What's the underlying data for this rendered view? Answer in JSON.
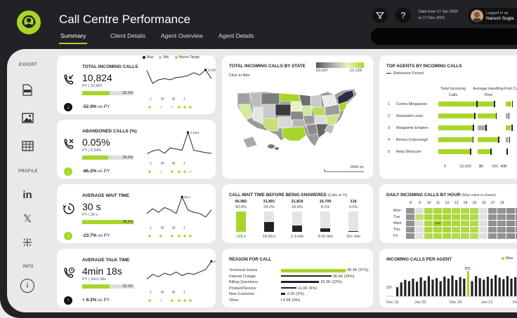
{
  "header": {
    "title": "Call Centre Performance",
    "tabs": [
      {
        "label": "Summary",
        "active": true
      },
      {
        "label": "Client Details",
        "active": false
      },
      {
        "label": "Agent Overview",
        "active": false
      },
      {
        "label": "Agent Details",
        "active": false
      }
    ],
    "date_from": "Data from 17 Jan 2020",
    "date_to": "to 17 Dec 2021",
    "logged_in_label": "Logged in as",
    "user_name": "Naresh Sugla",
    "help_symbol": "?"
  },
  "sidebar": {
    "export_label": "EXPORT",
    "profile_label": "PROFILE",
    "info_label": "INFO",
    "export_items": [
      "pdf-icon",
      "image-icon",
      "table-icon"
    ],
    "profile_items": [
      "linkedin-icon",
      "x-icon",
      "tableau-icon"
    ],
    "linkedin_text": "in",
    "x_text": "𝕏",
    "info_text": "i",
    "pdf_text": "PDF"
  },
  "legend": {
    "max": "Max",
    "min": "Min",
    "above": "Above Target"
  },
  "months": [
    "J",
    "M",
    "M",
    "J"
  ],
  "kpis": [
    {
      "title": "TOTAL INCOMING CALLS",
      "value": "10,824",
      "py": "PY | 22,982",
      "bar_pct": 0.521,
      "bar_label": "52.1%",
      "delta": "-52.9%",
      "delta_suffix": "vs PY",
      "delta_dir": "down",
      "peak_label": "22,982",
      "spark": [
        0.9,
        0.35,
        0.5,
        0.55,
        0.5,
        0.6,
        0.62,
        0.68,
        0.8,
        0.7,
        0.92,
        0.55
      ],
      "dots": [
        1,
        0,
        0,
        1,
        1,
        1
      ]
    },
    {
      "title": "ABANDONED CALLS (%)",
      "value": "0.05%",
      "py": "PY | 0.34%",
      "bar_pct": 0.502,
      "bar_label": "50.2%",
      "delta": "-86.2%",
      "delta_suffix": "vs PY",
      "delta_dir": "up",
      "peak_label": "2.14%",
      "spark": [
        0.1,
        0.22,
        0.28,
        0.12,
        0.35,
        0.3,
        0.25,
        1.0,
        0.25,
        0.2,
        0.15,
        0.12
      ],
      "dots": [
        1,
        0,
        1,
        1,
        1,
        0
      ]
    },
    {
      "title": "AVERAGE WAIT TIME",
      "value": "30 s",
      "py": "PY | 39 s",
      "bar_pct": 0.983,
      "bar_label": "98.3%",
      "delta": "-23.7%",
      "delta_suffix": "vs PY",
      "delta_dir": "down",
      "peak_label": "94 s",
      "spark": [
        0.3,
        0.5,
        0.35,
        0.55,
        0.45,
        0.3,
        1.0,
        0.45,
        0.35,
        0.3,
        0.15,
        0.45
      ],
      "dots": [
        1,
        1,
        1,
        1,
        1,
        1
      ]
    },
    {
      "title": "AVERAGE TALK TIME",
      "value": "4min 18s",
      "py": "PY | 3min 58s",
      "bar_pct": 0.521,
      "bar_label": "52.1%",
      "delta": "+ 8.3%",
      "delta_suffix": "vs PY",
      "delta_dir": "up-dark",
      "peak_label": "258",
      "spark": [
        0.25,
        0.45,
        0.35,
        0.5,
        0.42,
        0.55,
        0.4,
        0.5,
        0.45,
        0.55,
        0.65,
        1.0
      ],
      "dots": [
        1,
        0,
        1,
        1,
        1,
        1
      ]
    }
  ],
  "map_card": {
    "title": "TOTAL INCOMING CALLS BY STATE",
    "subtitle": "Click to filter",
    "legend_min": "10,697",
    "legend_max": "12,129",
    "scale_label": "1500 mi"
  },
  "agents_card": {
    "title": "TOP AGENTS BY INCOMING CALLS",
    "legend": "Reference Period",
    "columns": [
      "Total Incoming Calls",
      "Average Handling Time",
      "First Call Resolution"
    ],
    "agents": [
      {
        "rank": "1",
        "name": "Corine Mingasson",
        "calls": 0.95,
        "aht": 0.78,
        "fcr": 0.3
      },
      {
        "rank": "2",
        "name": "Reinwald Lowis",
        "calls": 0.9,
        "aht": 0.85,
        "fcr": 0.1
      },
      {
        "rank": "3",
        "name": "Margarete Empten",
        "calls": 0.87,
        "aht": 0.38,
        "fcr": 0.28
      },
      {
        "rank": "4",
        "name": "Brinna Colecrough",
        "calls": 0.86,
        "aht": 0.98,
        "fcr": 0.15
      },
      {
        "rank": "5",
        "name": "Reta Winscum",
        "calls": 0.8,
        "aht": 0.6,
        "fcr": 0.0
      }
    ],
    "axis1": [
      "0",
      "10,000",
      "20"
    ],
    "axis2": [
      "0",
      "200",
      "400",
      "0"
    ],
    "axis3": [
      "1"
    ]
  },
  "wait_card": {
    "title": "CALL WAIT TIME BEFORE BEING ANSWERED",
    "subtitle": "(Calls vs %)",
    "buckets": [
      {
        "count": "66,982",
        "pct": "50.8%",
        "frac": 0.51,
        "label": "<15 s",
        "color": "#a8d52a"
      },
      {
        "count": "31,891",
        "pct": "24.2%",
        "frac": 0.24,
        "label": "15-60 s",
        "color": "#222226"
      },
      {
        "count": "21,818",
        "pct": "16.6%",
        "frac": 0.166,
        "label": "1-3 min",
        "color": "#222226"
      },
      {
        "count": "10,709",
        "pct": "8.1%",
        "frac": 0.081,
        "label": "3-10 min",
        "color": "#222226"
      },
      {
        "count": "318",
        "pct": "0.2%",
        "frac": 0.01,
        "label": "10+ min",
        "color": "#222226"
      }
    ]
  },
  "reason_card": {
    "title": "REASON FOR CALL",
    "reasons": [
      {
        "label": "Technical Issues",
        "value": "49.3K (37%)",
        "frac": 1.0,
        "color": "#a8d52a"
      },
      {
        "label": "Internet Outage",
        "value": "38.4K (29%)",
        "frac": 0.78,
        "color": "#222226"
      },
      {
        "label": "Billing Questions",
        "value": "29.3K (22%)",
        "frac": 0.59,
        "color": "#222226"
      },
      {
        "label": "Product/Service",
        "value": "11.6K (9%)",
        "frac": 0.24,
        "color": "#222226"
      },
      {
        "label": "New Customer",
        "value": "3.2K (2%)",
        "frac": 0.07,
        "color": "#222226"
      },
      {
        "label": "Other",
        "value": "0.5K (0%)",
        "frac": 0.01,
        "color": "#222226"
      }
    ]
  },
  "hourly_card": {
    "title": "DAILY INCOMING CALLS BY HOUR",
    "subtitle": "(Max value is shown)",
    "hours": [
      "8",
      "9",
      "10",
      "11",
      "12",
      "13",
      "14",
      "15",
      "16",
      "17",
      "18"
    ],
    "days": [
      "Mon",
      "Tue",
      "Wed",
      "Thu",
      "Fri"
    ],
    "max_label": "8.09",
    "grid": [
      [
        0.3,
        0.55,
        0.8,
        0.85,
        0.85,
        0.8,
        0.8,
        0.75,
        0.45,
        0.3,
        0.3,
        0.25,
        0.25,
        0.2
      ],
      [
        0.3,
        0.6,
        0.85,
        0.9,
        0.9,
        0.85,
        0.85,
        0.8,
        0.45,
        0.3,
        0.3,
        0.25,
        0.25,
        0.2
      ],
      [
        0.3,
        0.55,
        0.8,
        1.0,
        0.9,
        0.85,
        0.8,
        0.75,
        0.45,
        0.3,
        0.3,
        0.25,
        0.25,
        0.2
      ],
      [
        0.3,
        0.55,
        0.8,
        0.85,
        0.85,
        0.8,
        0.8,
        0.75,
        0.45,
        0.3,
        0.3,
        0.25,
        0.25,
        0.2
      ],
      [
        0.3,
        0.5,
        0.75,
        0.8,
        0.8,
        0.75,
        0.75,
        0.7,
        0.45,
        0.3,
        0.3,
        0.25,
        0.25,
        0.2
      ]
    ]
  },
  "agent_calls_card": {
    "title": "INCOMING CALLS PER AGENT",
    "legend_max": "Max",
    "min_label": "297",
    "max_label": "821",
    "x_labels": [
      "Dec 19",
      "Jun 20",
      "Dec 20",
      "Jun 21",
      "Dec 21"
    ],
    "bars": [
      0.36,
      0.55,
      0.65,
      0.6,
      0.7,
      0.58,
      0.75,
      0.62,
      0.8,
      0.66,
      0.72,
      0.6,
      0.78,
      0.7,
      0.82,
      0.64,
      0.76,
      0.7,
      1.0,
      0.6,
      0.8,
      0.72,
      0.66,
      0.78,
      0.7,
      0.84,
      0.74,
      0.68,
      0.8,
      0.7,
      0.76,
      0.64,
      0.86,
      0.72
    ],
    "max_index": 18,
    "min_index": 0
  }
}
